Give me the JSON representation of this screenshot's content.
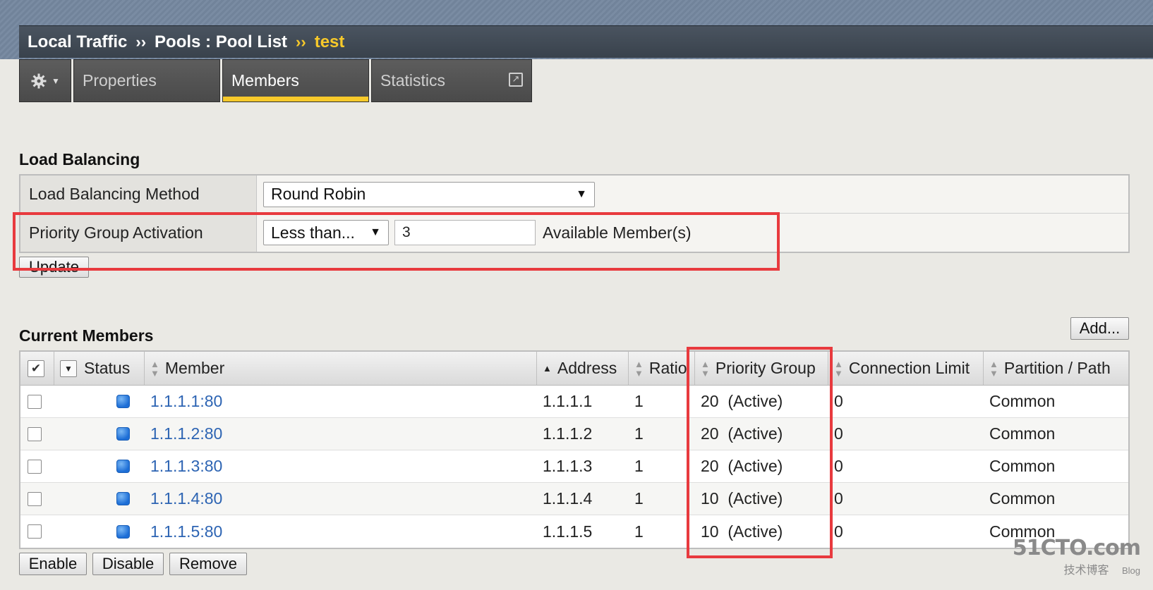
{
  "breadcrumb": {
    "items": [
      "Local Traffic",
      "Pools : Pool List"
    ],
    "separator": "››",
    "current": "test"
  },
  "tabs": [
    {
      "label": "Properties",
      "selected": false
    },
    {
      "label": "Members",
      "selected": true
    },
    {
      "label": "Statistics",
      "selected": false
    }
  ],
  "load_balancing": {
    "title": "Load Balancing",
    "method_label": "Load Balancing Method",
    "method_value": "Round Robin",
    "pga_label": "Priority Group Activation",
    "pga_mode": "Less than...",
    "pga_count": "3",
    "pga_suffix": "Available Member(s)",
    "update_label": "Update"
  },
  "members": {
    "title": "Current Members",
    "add_label": "Add...",
    "columns": [
      "Status",
      "Member",
      "Address",
      "Ratio",
      "Priority Group",
      "Connection Limit",
      "Partition / Path"
    ],
    "rows": [
      {
        "member": "1.1.1.1:80",
        "address": "1.1.1.1",
        "ratio": "1",
        "priority": "20  (Active)",
        "conn_limit": "0",
        "partition": "Common"
      },
      {
        "member": "1.1.1.2:80",
        "address": "1.1.1.2",
        "ratio": "1",
        "priority": "20  (Active)",
        "conn_limit": "0",
        "partition": "Common"
      },
      {
        "member": "1.1.1.3:80",
        "address": "1.1.1.3",
        "ratio": "1",
        "priority": "20  (Active)",
        "conn_limit": "0",
        "partition": "Common"
      },
      {
        "member": "1.1.1.4:80",
        "address": "1.1.1.4",
        "ratio": "1",
        "priority": "10  (Active)",
        "conn_limit": "0",
        "partition": "Common"
      },
      {
        "member": "1.1.1.5:80",
        "address": "1.1.1.5",
        "ratio": "1",
        "priority": "10  (Active)",
        "conn_limit": "0",
        "partition": "Common"
      }
    ],
    "actions": [
      "Enable",
      "Disable",
      "Remove"
    ]
  },
  "watermark": {
    "brand": "51CTO.com",
    "sub": "技术博客",
    "blog": "Blog"
  },
  "colors": {
    "accent": "#f7c92a",
    "highlight": "#e83a3e",
    "link": "#2d64b3",
    "status": "#1d6ed6"
  }
}
